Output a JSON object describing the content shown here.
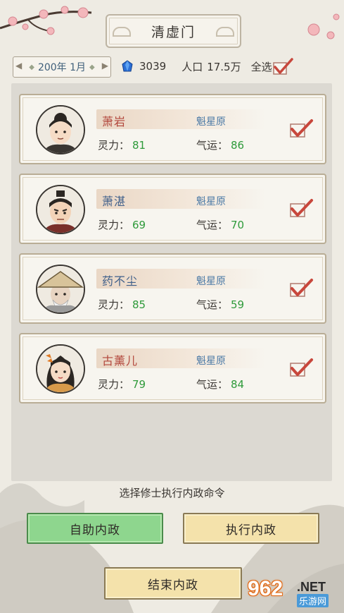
{
  "header": {
    "title": "清虚门",
    "date": "200年 1月",
    "spirit_stones": "3039",
    "population_label": "人口",
    "population_value": "17.5万",
    "select_all_label": "全选"
  },
  "disciples": [
    {
      "name": "萧岩",
      "name_color": "#b2473c",
      "location": "魁星原",
      "lingli_label": "灵力：",
      "lingli": "81",
      "qiyun_label": "气运：",
      "qiyun": "86",
      "checked": true
    },
    {
      "name": "萧湛",
      "name_color": "#3f5f8a",
      "location": "魁星原",
      "lingli_label": "灵力：",
      "lingli": "69",
      "qiyun_label": "气运：",
      "qiyun": "70",
      "checked": true
    },
    {
      "name": "药不尘",
      "name_color": "#3f5f8a",
      "location": "魁星原",
      "lingli_label": "灵力：",
      "lingli": "85",
      "qiyun_label": "气运：",
      "qiyun": "59",
      "checked": true
    },
    {
      "name": "古薰儿",
      "name_color": "#b2473c",
      "location": "魁星原",
      "lingli_label": "灵力：",
      "lingli": "79",
      "qiyun_label": "气运：",
      "qiyun": "84",
      "checked": true
    }
  ],
  "hint": "选择修士执行内政命令",
  "buttons": {
    "auto": "自助内政",
    "execute": "执行内政",
    "end": "结束内政"
  },
  "watermark": {
    "number": "962",
    "net": ".NET",
    "site": "乐游网"
  },
  "colors": {
    "accent_green": "#2e9a3a",
    "location_blue": "#4c7aa6",
    "check_red": "#c8473c"
  },
  "icons": {
    "gem": "blue-gem-icon",
    "check": "red-check-icon"
  }
}
